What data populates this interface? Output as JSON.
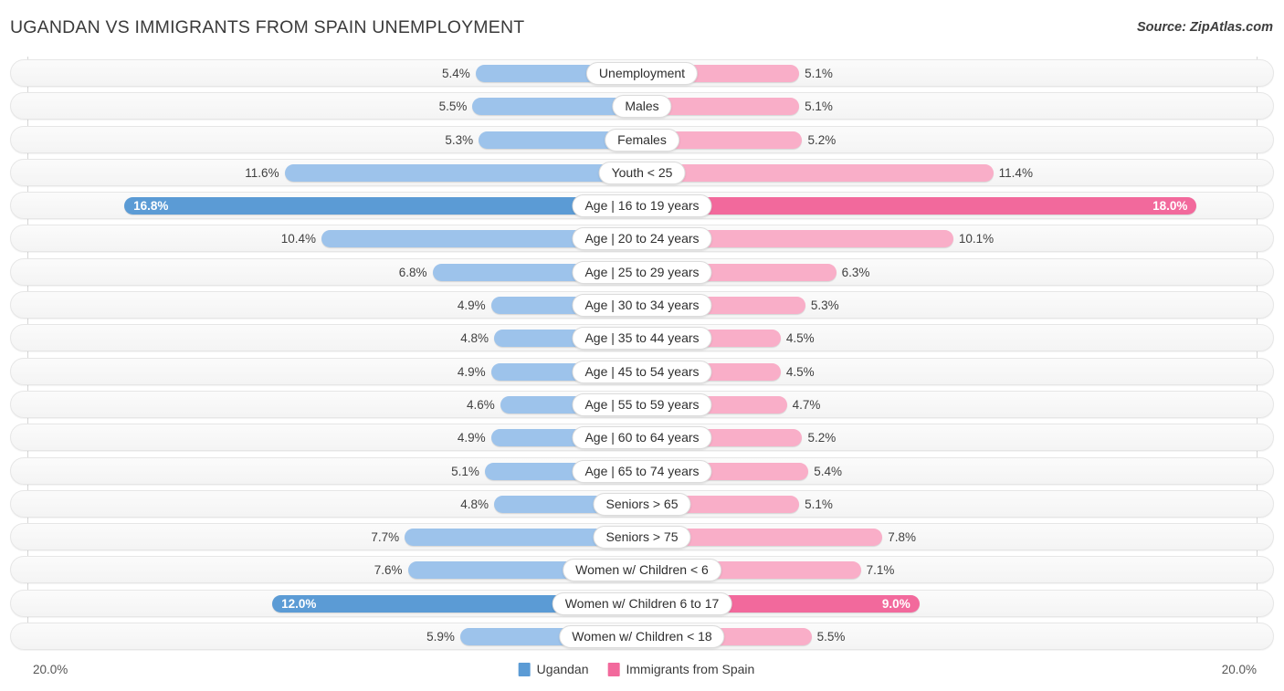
{
  "header": {
    "title": "UGANDAN VS IMMIGRANTS FROM SPAIN UNEMPLOYMENT",
    "source": "Source: ZipAtlas.com"
  },
  "footer": {
    "axis_min_label": "20.0%",
    "axis_max_label": "20.0%",
    "legend": [
      {
        "label": "Ugandan",
        "color": "#5b9bd5"
      },
      {
        "label": "Immigrants from Spain",
        "color": "#f2699c"
      }
    ]
  },
  "colors": {
    "left_light": "#9dc3eb",
    "left_dark": "#5b9bd5",
    "right_light": "#f9aec8",
    "right_dark": "#f2699c",
    "track": "#f6f6f6",
    "gridline": "#d6d6d6"
  },
  "chart_data": {
    "type": "bar",
    "orientation": "horizontal-diverging",
    "title": "UGANDAN VS IMMIGRANTS FROM SPAIN UNEMPLOYMENT",
    "xlabel": "",
    "ylabel": "",
    "xlim": [
      20.0,
      20.0
    ],
    "axis_max": 20.0,
    "grid": true,
    "legend_position": "bottom-center",
    "series": [
      {
        "name": "Ugandan",
        "side": "left",
        "values": [
          5.4,
          5.5,
          5.3,
          11.6,
          16.8,
          10.4,
          6.8,
          4.9,
          4.8,
          4.9,
          4.6,
          4.9,
          5.1,
          4.8,
          7.7,
          7.6,
          12.0,
          5.9
        ]
      },
      {
        "name": "Immigrants from Spain",
        "side": "right",
        "values": [
          5.1,
          5.1,
          5.2,
          11.4,
          18.0,
          10.1,
          6.3,
          5.3,
          4.5,
          4.5,
          4.7,
          5.2,
          5.4,
          5.1,
          7.8,
          7.1,
          9.0,
          5.5
        ]
      }
    ],
    "categories": [
      "Unemployment",
      "Males",
      "Females",
      "Youth < 25",
      "Age | 16 to 19 years",
      "Age | 20 to 24 years",
      "Age | 25 to 29 years",
      "Age | 30 to 34 years",
      "Age | 35 to 44 years",
      "Age | 45 to 54 years",
      "Age | 55 to 59 years",
      "Age | 60 to 64 years",
      "Age | 65 to 74 years",
      "Seniors > 65",
      "Seniors > 75",
      "Women w/ Children < 6",
      "Women w/ Children 6 to 17",
      "Women w/ Children < 18"
    ],
    "rows": [
      {
        "category": "Unemployment",
        "left_value": 5.4,
        "left_label": "5.4%",
        "right_value": 5.1,
        "right_label": "5.1%",
        "highlight": false
      },
      {
        "category": "Males",
        "left_value": 5.5,
        "left_label": "5.5%",
        "right_value": 5.1,
        "right_label": "5.1%",
        "highlight": false
      },
      {
        "category": "Females",
        "left_value": 5.3,
        "left_label": "5.3%",
        "right_value": 5.2,
        "right_label": "5.2%",
        "highlight": false
      },
      {
        "category": "Youth < 25",
        "left_value": 11.6,
        "left_label": "11.6%",
        "right_value": 11.4,
        "right_label": "11.4%",
        "highlight": false
      },
      {
        "category": "Age | 16 to 19 years",
        "left_value": 16.8,
        "left_label": "16.8%",
        "right_value": 18.0,
        "right_label": "18.0%",
        "highlight": true
      },
      {
        "category": "Age | 20 to 24 years",
        "left_value": 10.4,
        "left_label": "10.4%",
        "right_value": 10.1,
        "right_label": "10.1%",
        "highlight": false
      },
      {
        "category": "Age | 25 to 29 years",
        "left_value": 6.8,
        "left_label": "6.8%",
        "right_value": 6.3,
        "right_label": "6.3%",
        "highlight": false
      },
      {
        "category": "Age | 30 to 34 years",
        "left_value": 4.9,
        "left_label": "4.9%",
        "right_value": 5.3,
        "right_label": "5.3%",
        "highlight": false
      },
      {
        "category": "Age | 35 to 44 years",
        "left_value": 4.8,
        "left_label": "4.8%",
        "right_value": 4.5,
        "right_label": "4.5%",
        "highlight": false
      },
      {
        "category": "Age | 45 to 54 years",
        "left_value": 4.9,
        "left_label": "4.9%",
        "right_value": 4.5,
        "right_label": "4.5%",
        "highlight": false
      },
      {
        "category": "Age | 55 to 59 years",
        "left_value": 4.6,
        "left_label": "4.6%",
        "right_value": 4.7,
        "right_label": "4.7%",
        "highlight": false
      },
      {
        "category": "Age | 60 to 64 years",
        "left_value": 4.9,
        "left_label": "4.9%",
        "right_value": 5.2,
        "right_label": "5.2%",
        "highlight": false
      },
      {
        "category": "Age | 65 to 74 years",
        "left_value": 5.1,
        "left_label": "5.1%",
        "right_value": 5.4,
        "right_label": "5.4%",
        "highlight": false
      },
      {
        "category": "Seniors > 65",
        "left_value": 4.8,
        "left_label": "4.8%",
        "right_value": 5.1,
        "right_label": "5.1%",
        "highlight": false
      },
      {
        "category": "Seniors > 75",
        "left_value": 7.7,
        "left_label": "7.7%",
        "right_value": 7.8,
        "right_label": "7.8%",
        "highlight": false
      },
      {
        "category": "Women w/ Children < 6",
        "left_value": 7.6,
        "left_label": "7.6%",
        "right_value": 7.1,
        "right_label": "7.1%",
        "highlight": false
      },
      {
        "category": "Women w/ Children 6 to 17",
        "left_value": 12.0,
        "left_label": "12.0%",
        "right_value": 9.0,
        "right_label": "9.0%",
        "highlight": true
      },
      {
        "category": "Women w/ Children < 18",
        "left_value": 5.9,
        "left_label": "5.9%",
        "right_value": 5.5,
        "right_label": "5.5%",
        "highlight": false
      }
    ]
  }
}
